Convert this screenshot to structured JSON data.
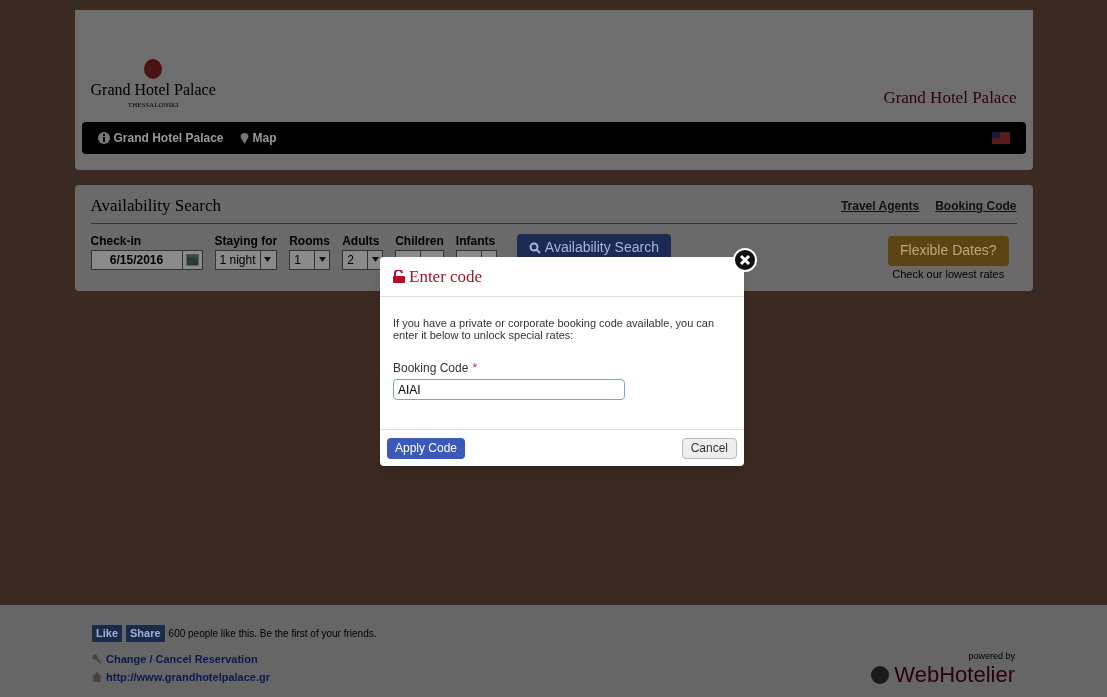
{
  "header": {
    "logo_name": "Grand Hotel Palace",
    "logo_city": "THESSALONIKI",
    "title": "Grand Hotel Palace"
  },
  "nav": {
    "items": [
      {
        "label": "Grand Hotel Palace"
      },
      {
        "label": "Map"
      }
    ]
  },
  "search": {
    "title": "Availability Search",
    "links": [
      "Travel Agents",
      "Booking Code"
    ],
    "fields": [
      {
        "label": "Check-in",
        "value": "6/15/2016",
        "kind": "date"
      },
      {
        "label": "Staying for",
        "value": "1 night",
        "kind": "select"
      },
      {
        "label": "Rooms",
        "value": "1",
        "kind": "select"
      },
      {
        "label": "Adults",
        "value": "2",
        "kind": "select"
      },
      {
        "label": "Children",
        "kind": "select"
      },
      {
        "label": "Infants",
        "kind": "select"
      }
    ],
    "search_button": "Availability Search",
    "flexible_button": "Flexible Dates?",
    "flexible_note": "Check our lowest rates"
  },
  "modal": {
    "title": "Enter code",
    "text": "If you have a private or corporate booking code available, you can enter it below to unlock special rates:",
    "field_label": "Booking Code",
    "required_mark": "*",
    "value": "AIAI",
    "apply": "Apply Code",
    "cancel": "Cancel"
  },
  "footer": {
    "like": "Like",
    "share": "Share",
    "like_text": "600 people like this. Be the first of your friends.",
    "links": [
      {
        "label": "Change / Cancel Reservation"
      },
      {
        "label": "http://www.grandhotelpalace.gr"
      }
    ],
    "powered_by": "powered by",
    "brand": "WebHotelier"
  }
}
